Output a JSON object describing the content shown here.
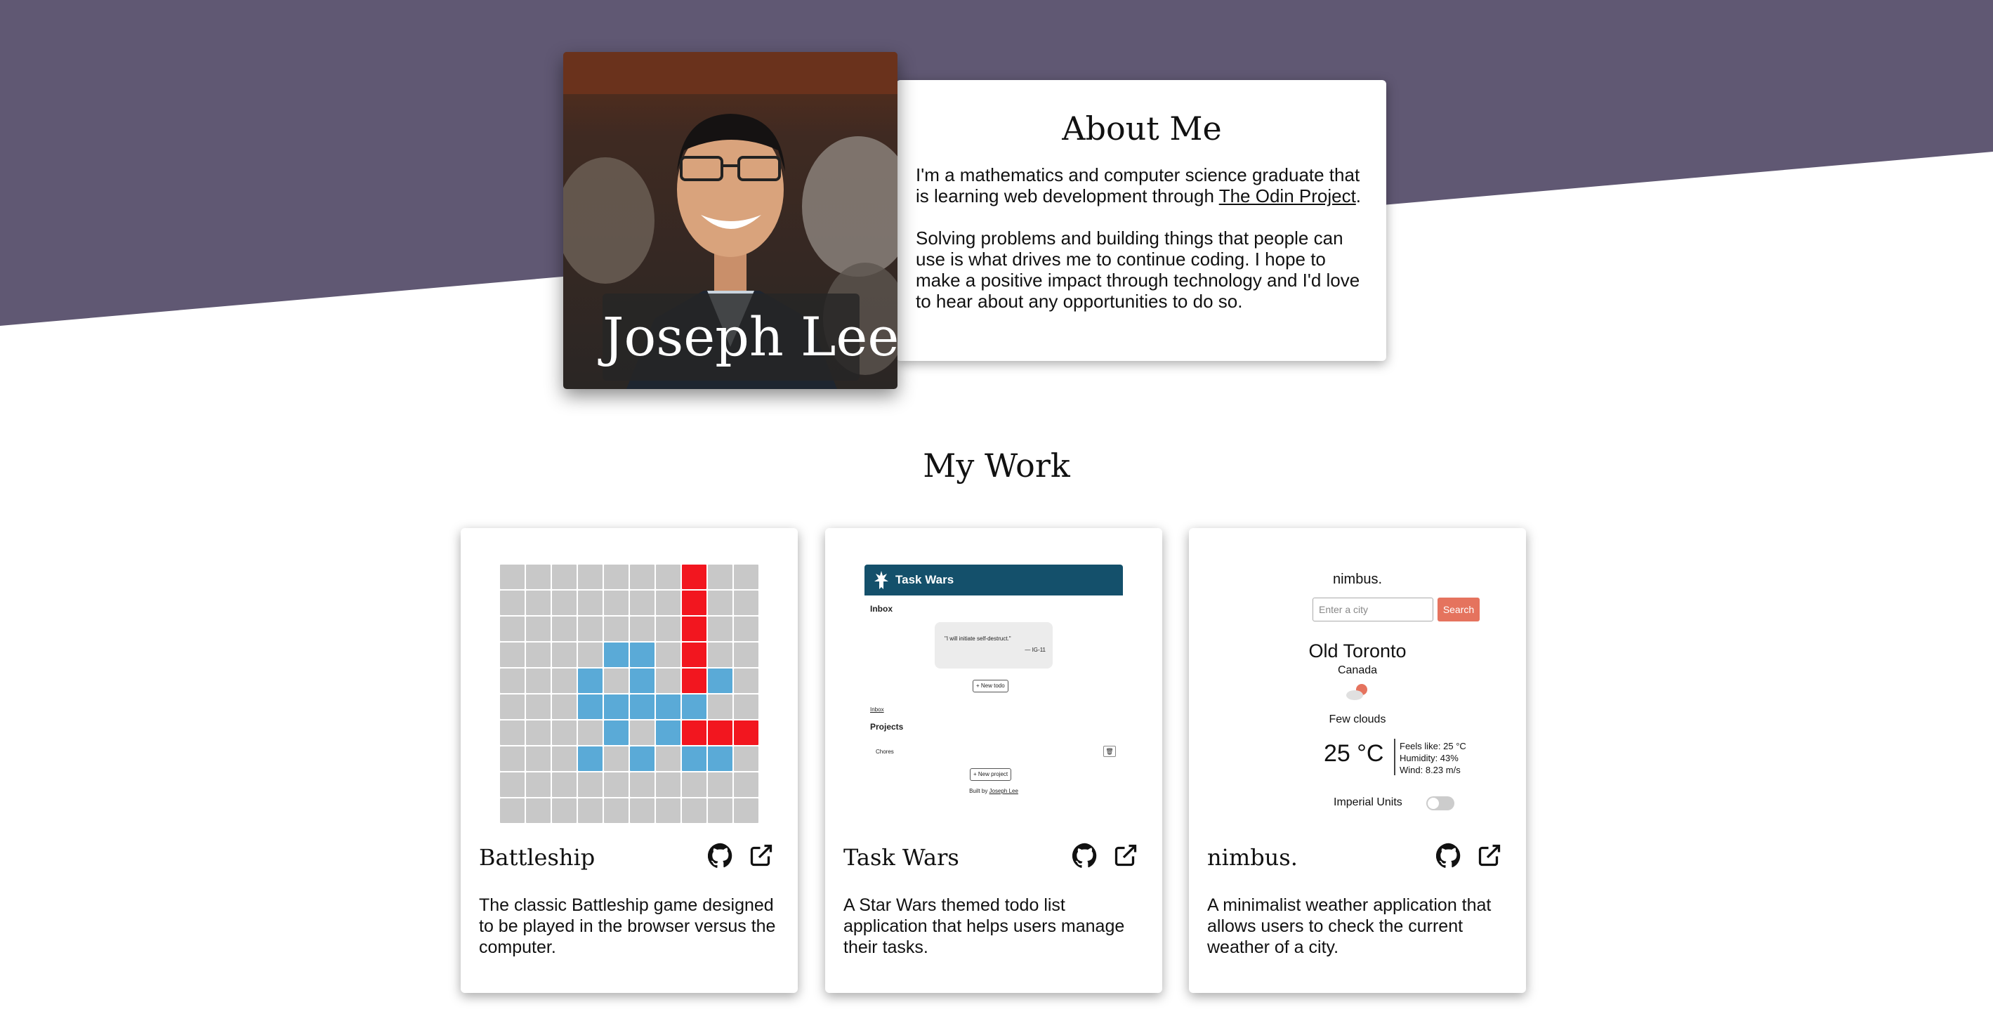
{
  "colors": {
    "hero_band": "#605873",
    "github": "#111111",
    "battleship_ship": "#5aaad7",
    "battleship_hit": "#f2161f",
    "taskwars_bar": "#14506b",
    "nimbus_search": "#e5735e"
  },
  "hero": {
    "name": "Joseph Lee",
    "photo_alt": "portrait-photo"
  },
  "about": {
    "heading": "About Me",
    "p1_before": "I'm a mathematics and computer science graduate that is learning web development through ",
    "p1_link": "The Odin Project",
    "p1_after": ".",
    "p2": "Solving problems and building things that people can use is what drives me to continue coding. I hope to make a positive impact through technology and I'd love to hear about any opportunities to do so."
  },
  "work": {
    "heading": "My Work",
    "projects": [
      {
        "title": "Battleship",
        "description": "The classic Battleship game designed to be played in the browser versus the computer.",
        "icons": [
          "github-icon",
          "external-link-icon"
        ]
      },
      {
        "title": "Task Wars",
        "description": "A Star Wars themed todo list application that helps users manage their tasks.",
        "icons": [
          "github-icon",
          "external-link-icon"
        ]
      },
      {
        "title": "nimbus.",
        "description": "A minimalist weather application that allows users to check the current weather of a city.",
        "icons": [
          "github-icon",
          "external-link-icon"
        ]
      }
    ]
  },
  "battleship": {
    "grid": [
      "0000000200",
      "0000000200",
      "0000000200",
      "0000110200",
      "0001010210",
      "0001111100",
      "0000101222",
      "0001010110",
      "0000000000",
      "0000000000"
    ]
  },
  "taskwars": {
    "app_title": "Task Wars",
    "inbox": "Inbox",
    "quote": "\"I will initiate self-destruct.\"",
    "quote_author": "— IG-11",
    "new_todo": "+ New todo",
    "inbox_link": "Inbox",
    "projects": "Projects",
    "project_item": "Chores",
    "new_project": "+ New project",
    "credit_before": "Built by ",
    "credit_name": "Joseph Lee"
  },
  "nimbus": {
    "app_title": "nimbus.",
    "input_placeholder": "Enter a city",
    "search_label": "Search",
    "city": "Old Toronto",
    "country": "Canada",
    "weather_desc": "Few clouds",
    "temperature": "25 °C",
    "feels_like": "Feels like: 25 °C",
    "humidity": "Humidity: 43%",
    "wind": "Wind: 8.23 m/s",
    "units_label": "Imperial Units"
  }
}
